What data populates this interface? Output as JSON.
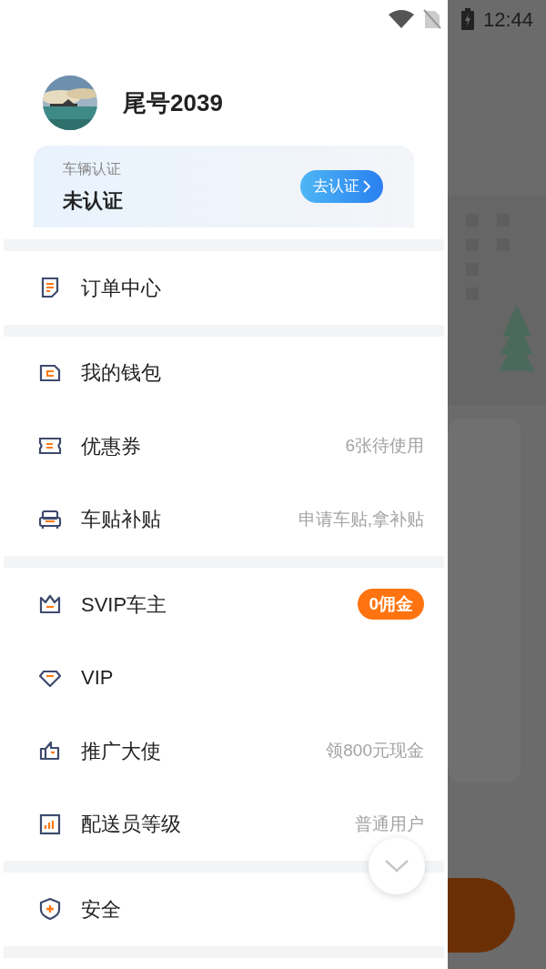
{
  "status_bar": {
    "time": "12:44"
  },
  "profile": {
    "name": "尾号2039"
  },
  "vehicle_card": {
    "caption": "车辆认证",
    "status": "未认证",
    "button": "去认证"
  },
  "sections": [
    {
      "items": [
        {
          "label": "订单中心"
        }
      ]
    },
    {
      "items": [
        {
          "label": "我的钱包"
        },
        {
          "label": "优惠券",
          "detail": "6张待使用"
        },
        {
          "label": "车贴补贴",
          "detail": "申请车贴,拿补贴"
        }
      ]
    },
    {
      "items": [
        {
          "label": "SVIP车主",
          "badge": "0佣金"
        },
        {
          "label": "VIP"
        },
        {
          "label": "推广大使",
          "detail": "领800元现金"
        },
        {
          "label": "配送员等级",
          "detail": "普通用户"
        }
      ]
    },
    {
      "items": [
        {
          "label": "安全"
        }
      ]
    }
  ]
}
